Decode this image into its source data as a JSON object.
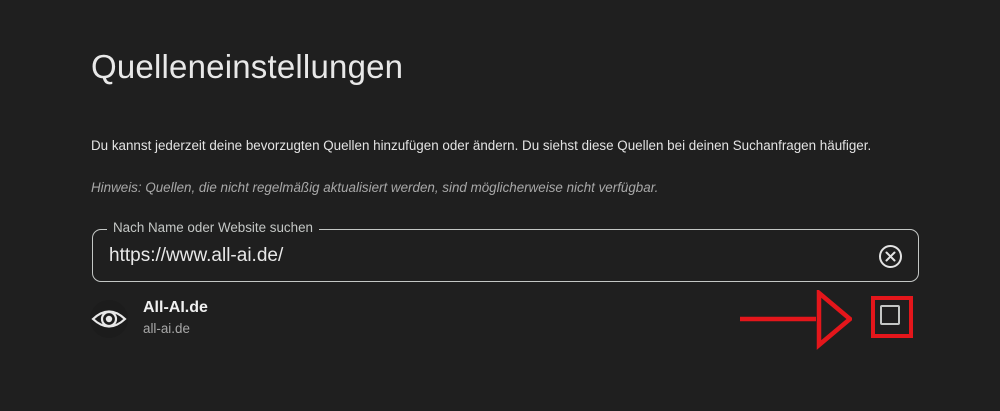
{
  "page": {
    "title": "Quelleneinstellungen",
    "description": "Du kannst jederzeit deine bevorzugten Quellen hinzufügen oder ändern. Du siehst diese Quellen bei deinen Suchanfragen häufiger.",
    "hint": "Hinweis: Quellen, die nicht regelmäßig aktualisiert werden, sind möglicherweise nicht verfügbar."
  },
  "search": {
    "label": "Nach Name oder Website suchen",
    "value": "https://www.all-ai.de/",
    "clear_icon": "close-circle-icon"
  },
  "results": [
    {
      "name": "All-AI.de",
      "domain": "all-ai.de",
      "icon": "eye-logo-icon",
      "checked": false
    }
  ],
  "annotation": {
    "arrow_color": "#e4161b",
    "box_color": "#e4161b"
  },
  "colors": {
    "background": "#1f1f1f",
    "text": "#e3e3e3",
    "muted": "#a8a8a8",
    "outline": "#c4c7c5"
  }
}
